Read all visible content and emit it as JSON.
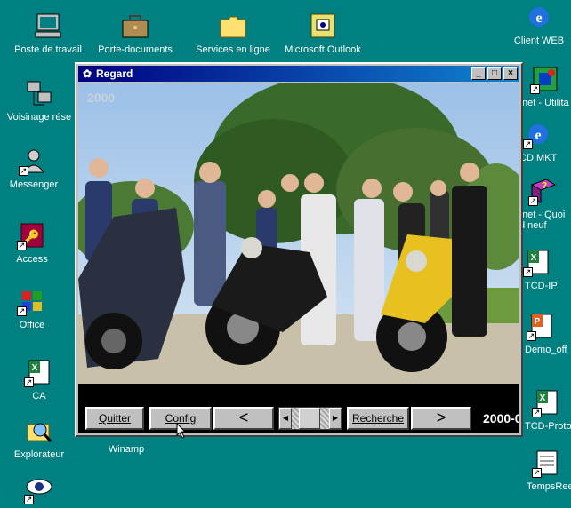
{
  "desktop": {
    "icons": [
      {
        "label": "Poste de travail",
        "icon": "computer-icon"
      },
      {
        "label": "Porte-documents",
        "icon": "briefcase-icon"
      },
      {
        "label": "Services en ligne",
        "icon": "folder-icon"
      },
      {
        "label": "Microsoft Outlook",
        "icon": "outlook-icon"
      },
      {
        "label": "Client WEB",
        "icon": "internet-explorer-icon"
      },
      {
        "label": "Voisinage rése",
        "icon": "network-icon"
      },
      {
        "label": "Messenger",
        "icon": "messenger-icon"
      },
      {
        "label": "Access",
        "icon": "access-icon"
      },
      {
        "label": "Office",
        "icon": "office-icon"
      },
      {
        "label": "CA",
        "icon": "excel-icon"
      },
      {
        "label": "Explorateur",
        "icon": "explorer-icon"
      },
      {
        "label": "Winamp",
        "icon": "winamp-icon"
      },
      {
        "label": "tnet - Utilita",
        "icon": "utility-icon"
      },
      {
        "label": "CD MKT",
        "icon": "internet-explorer-icon"
      },
      {
        "label": "tnet - Quoi d neuf",
        "icon": "help-book-icon"
      },
      {
        "label": "TCD-IP",
        "icon": "excel-icon"
      },
      {
        "label": "Demo_off",
        "icon": "powerpoint-icon"
      },
      {
        "label": "TCD-Proto",
        "icon": "excel-icon"
      },
      {
        "label": "TempsRee",
        "icon": "document-icon"
      }
    ]
  },
  "window": {
    "title": "Regard",
    "photo_overlay": "2000",
    "buttons": {
      "quit": "Quitter",
      "config": "Config",
      "prev": "<",
      "search": "Recherche",
      "next": ">"
    },
    "date_text": "2000-0"
  },
  "colors": {
    "desktop": "#008080",
    "title_start": "#000080",
    "title_end": "#1084d0"
  }
}
